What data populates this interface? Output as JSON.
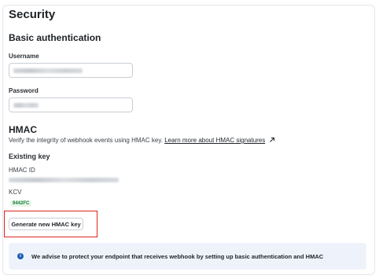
{
  "page": {
    "title": "Security"
  },
  "basic_auth": {
    "heading": "Basic authentication",
    "username_label": "Username",
    "password_label": "Password"
  },
  "hmac": {
    "heading": "HMAC",
    "description": "Verify the integrity of webhook events using HMAC key.",
    "learn_more_link": "Learn more about HMAC signatures",
    "link_icon": "external-link-arrow-icon",
    "existing_key_heading": "Existing key",
    "hmac_id_label": "HMAC ID",
    "kcv_label": "KCV",
    "kcv_value": "9442FC",
    "generate_button": "Generate new HMAC key"
  },
  "notice": {
    "icon": "info-icon",
    "text": "We advise to protect your endpoint that receives webhook by setting up basic authentication and HMAC"
  },
  "colors": {
    "highlight": "#e0231e",
    "notice_bg": "#eef3fb",
    "info_icon": "#1f5fb8",
    "kcv_text": "#1a7f37"
  }
}
